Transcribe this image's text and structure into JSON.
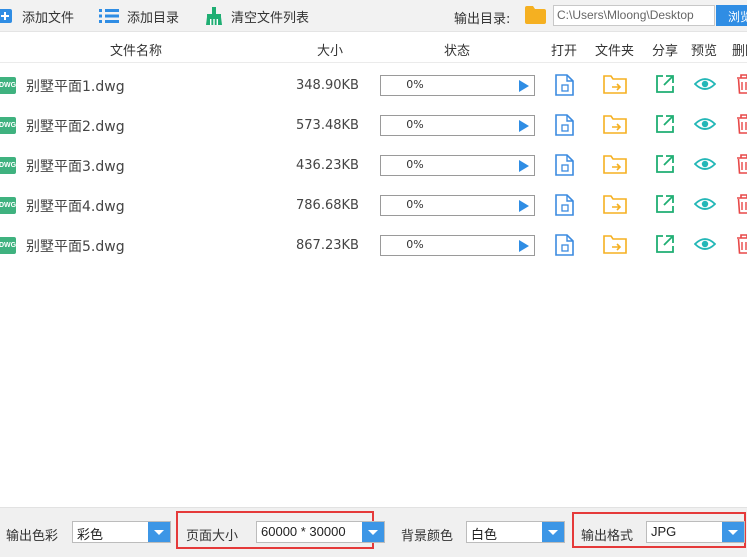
{
  "toolbar": {
    "add_file": "添加文件",
    "add_dir": "添加目录",
    "clear_list": "清空文件列表",
    "output_dir_label": "输出目录:",
    "output_path": "C:\\Users\\Mloong\\Desktop",
    "browse": "浏览"
  },
  "columns": {
    "name": "文件名称",
    "size": "大小",
    "status": "状态",
    "open": "打开",
    "folder": "文件夹",
    "share": "分享",
    "preview": "预览",
    "delete": "删除"
  },
  "file_badge": "DWG",
  "files": [
    {
      "name": "别墅平面1.dwg",
      "size": "348.90KB",
      "progress_label": "0%",
      "progress": 0
    },
    {
      "name": "别墅平面2.dwg",
      "size": "573.48KB",
      "progress_label": "0%",
      "progress": 0
    },
    {
      "name": "别墅平面3.dwg",
      "size": "436.23KB",
      "progress_label": "0%",
      "progress": 0
    },
    {
      "name": "别墅平面4.dwg",
      "size": "786.68KB",
      "progress_label": "0%",
      "progress": 0
    },
    {
      "name": "别墅平面5.dwg",
      "size": "867.23KB",
      "progress_label": "0%",
      "progress": 0
    }
  ],
  "bottom": {
    "color_label": "输出色彩",
    "color_value": "彩色",
    "page_size_label": "页面大小",
    "page_size_value": "60000 * 30000",
    "bg_label": "背景颜色",
    "bg_value": "白色",
    "format_label": "输出格式",
    "format_value": "JPG"
  },
  "colors": {
    "accent": "#2f8de4",
    "open_icon": "#3c8be0",
    "folder_icon": "#f5b021",
    "share_icon": "#1fae73",
    "preview_icon": "#23b7b7",
    "delete_icon": "#e84848",
    "highlight": "#e53a3a"
  },
  "icons": {
    "add_file": "plus-icon",
    "add_dir": "list-icon",
    "clear_list": "broom-icon",
    "open": "document-icon",
    "folder": "folder-arrow-icon",
    "share": "share-external-icon",
    "preview": "eye-icon",
    "delete": "trash-icon",
    "play": "play-icon"
  }
}
